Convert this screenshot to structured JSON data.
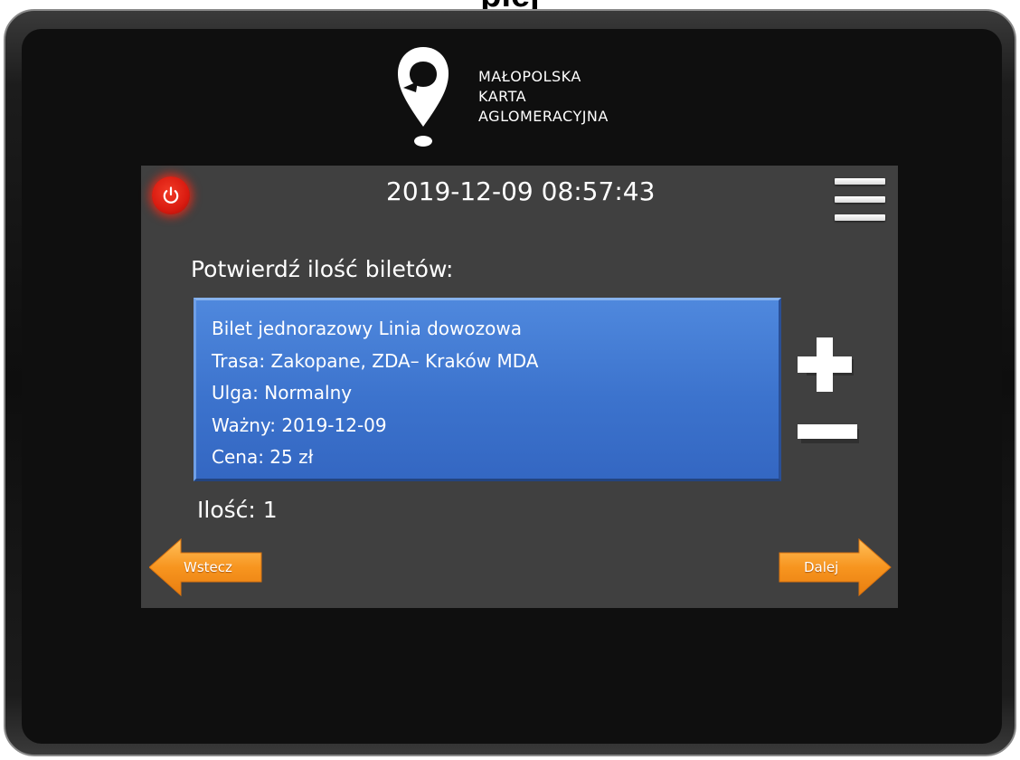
{
  "top_title": "plej",
  "brand": {
    "logo_icon": "map-pin-logo-icon",
    "lines": [
      "MAŁOPOLSKA",
      "KARTA",
      "AGLOMERACYJNA"
    ]
  },
  "header": {
    "datetime": "2019-12-09 08:57:43",
    "power_icon": "power-icon",
    "menu_icon": "hamburger-menu-icon"
  },
  "prompt": "Potwierdź ilość biletów:",
  "ticket": {
    "lines": [
      "Bilet jednorazowy  Linia dowozowa",
      "Trasa: Zakopane, ZDA– Kraków  MDA",
      "Ulga: Normalny",
      "Ważny: 2019-12-09",
      "Cena: 25 zł"
    ]
  },
  "stepper": {
    "plus_icon": "plus-icon",
    "minus_icon": "minus-icon"
  },
  "quantity_label": "Ilość: 1",
  "nav": {
    "back_label": "Wstecz",
    "next_label": "Dalej"
  },
  "colors": {
    "screen_bg": "#404040",
    "ticket_blue": "#3c73cd",
    "power_red": "#d91b10",
    "arrow_orange": "#f7951f"
  }
}
